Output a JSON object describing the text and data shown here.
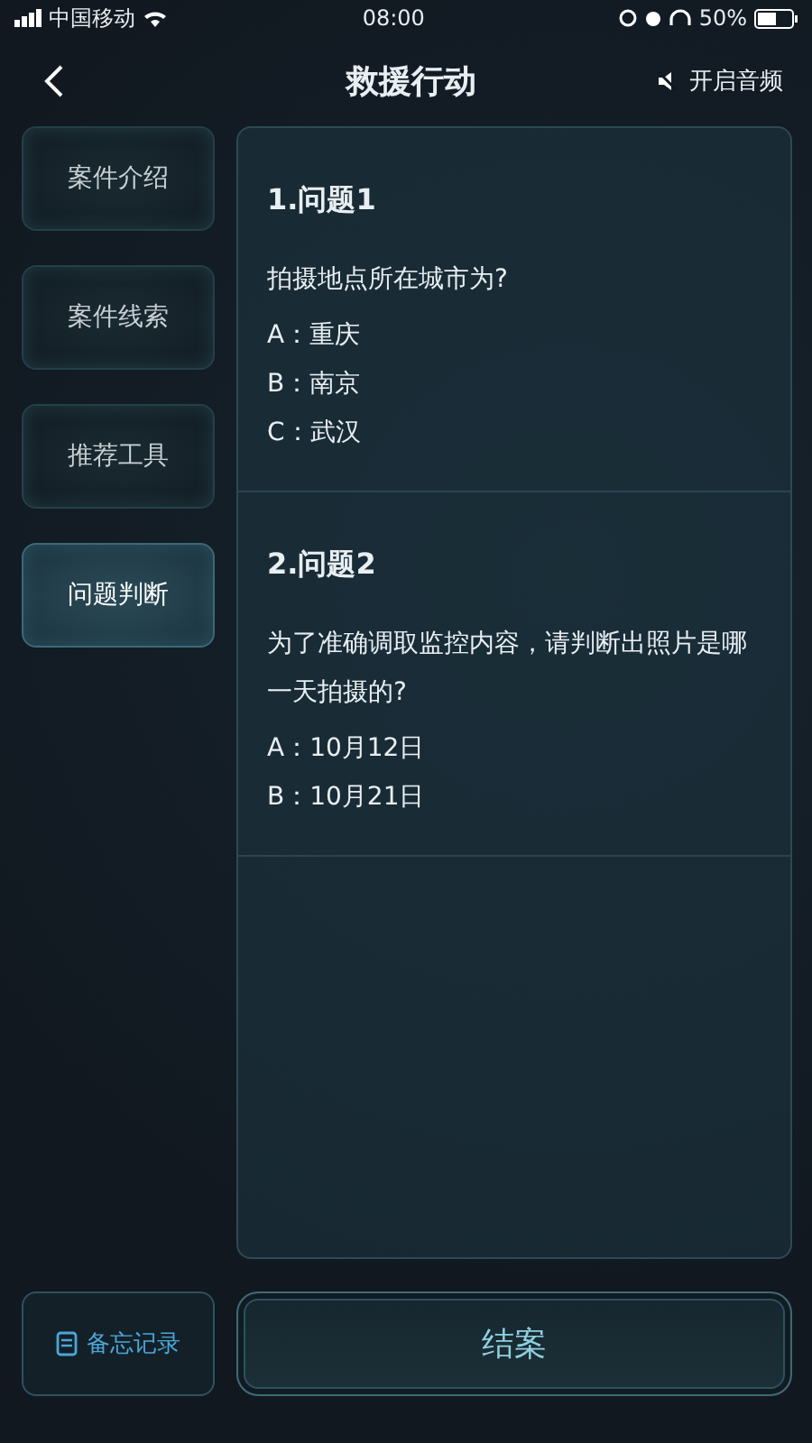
{
  "status_bar": {
    "carrier": "中国移动",
    "time": "08:00",
    "battery": "50%"
  },
  "header": {
    "title": "救援行动",
    "audio": "开启音频"
  },
  "tabs": [
    {
      "label": "案件介绍",
      "selected": false
    },
    {
      "label": "案件线索",
      "selected": false
    },
    {
      "label": "推荐工具",
      "selected": false
    },
    {
      "label": "问题判断",
      "selected": true
    }
  ],
  "questions": [
    {
      "title": "1.问题1",
      "prompt": "拍摄地点所在城市为?",
      "options": [
        "A：重庆",
        "B：南京",
        "C：武汉"
      ]
    },
    {
      "title": "2.问题2",
      "prompt": "为了准确调取监控内容，请判断出照片是哪一天拍摄的?",
      "options": [
        "A：10月12日",
        "B：10月21日"
      ]
    }
  ],
  "footer": {
    "notes": "备忘记录",
    "submit": "结案"
  }
}
